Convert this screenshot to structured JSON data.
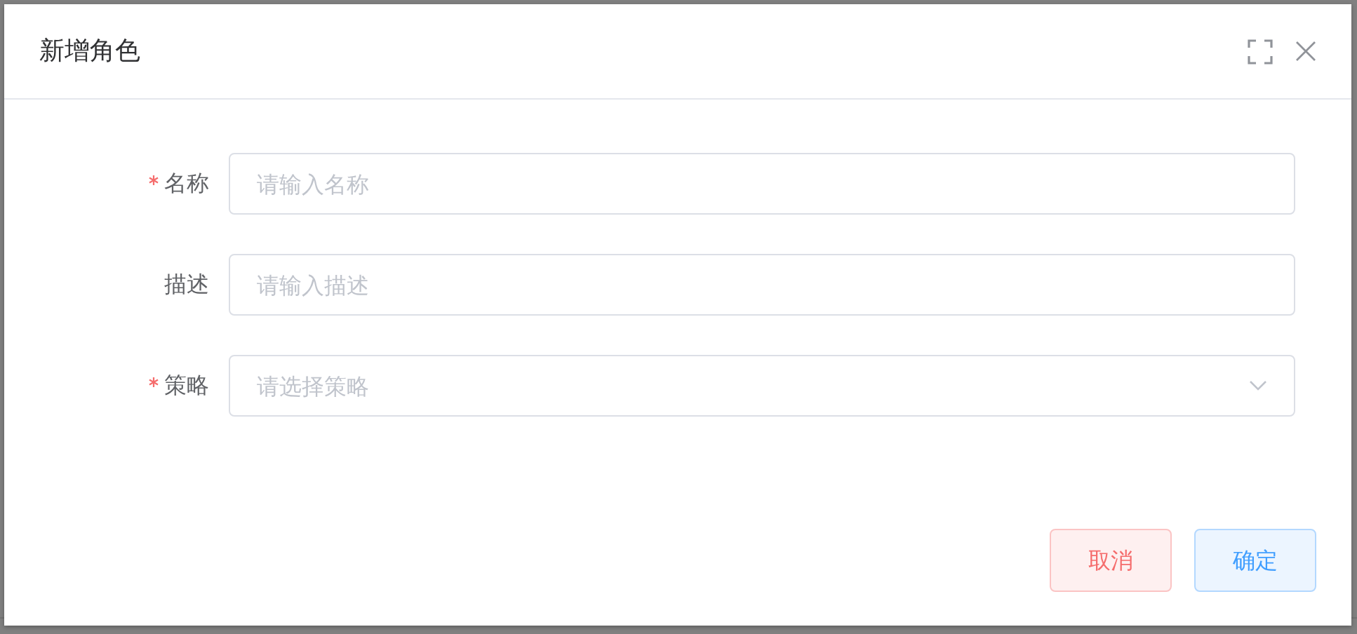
{
  "dialog": {
    "title": "新增角色",
    "fields": [
      {
        "label": "名称",
        "kind": "input",
        "required": true,
        "placeholder": "请输入名称"
      },
      {
        "label": "描述",
        "kind": "input",
        "required": false,
        "placeholder": "请输入描述"
      },
      {
        "label": "策略",
        "kind": "select",
        "required": true,
        "placeholder": "请选择策略"
      }
    ],
    "buttons": [
      {
        "label": "取消",
        "kind": "danger"
      },
      {
        "label": "确定",
        "kind": "primary"
      }
    ]
  }
}
